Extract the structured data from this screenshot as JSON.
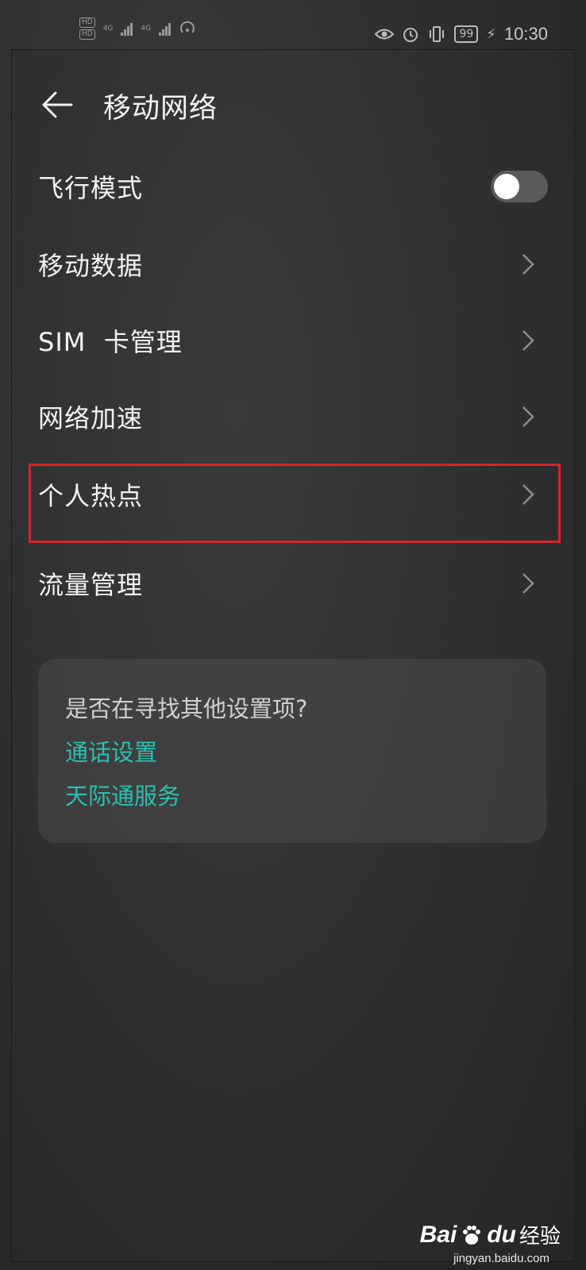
{
  "status": {
    "hd1": "HD",
    "hd2": "HD",
    "net1": "4G",
    "net2": "4G",
    "battery": "99",
    "time": "10:30",
    "icons": [
      "eye-icon",
      "alarm-icon",
      "vibrate-icon",
      "battery-icon",
      "charging-icon"
    ]
  },
  "header": {
    "title": "移动网络"
  },
  "rows": [
    {
      "label": "飞行模式",
      "type": "toggle",
      "on": false
    },
    {
      "label": "移动数据",
      "type": "chevron"
    },
    {
      "label": "SIM  卡管理",
      "type": "chevron"
    },
    {
      "label": "网络加速",
      "type": "chevron"
    },
    {
      "label": "个人热点",
      "type": "chevron",
      "highlighted": true
    },
    {
      "label": "流量管理",
      "type": "chevron"
    }
  ],
  "suggest": {
    "question": "是否在寻找其他设置项?",
    "links": [
      "通话设置",
      "天际通服务"
    ]
  },
  "colors": {
    "accent": "#2bbfae",
    "highlight": "#d9232e"
  },
  "watermark": {
    "brand": "Bai",
    "brand2": "du",
    "cn": "经验",
    "url": "jingyan.baidu.com"
  }
}
